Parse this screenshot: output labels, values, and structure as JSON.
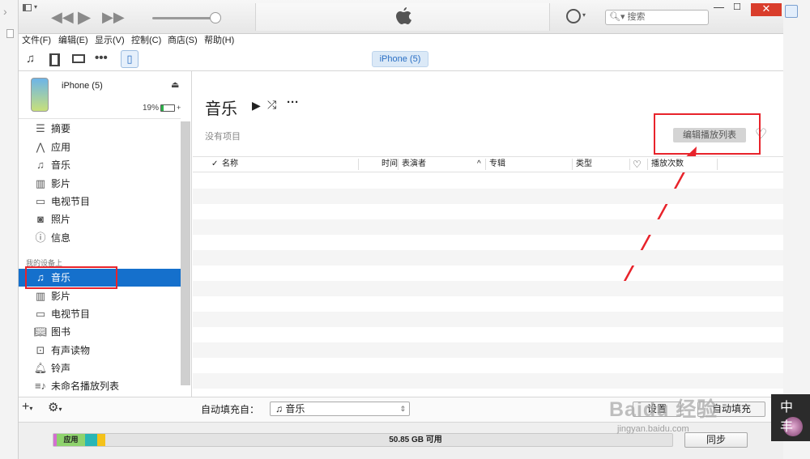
{
  "titlebar": {
    "search_placeholder": "搜索",
    "close_symbol": "✕",
    "minimize_symbol": "—",
    "maximize_symbol": "☐"
  },
  "menubar": {
    "items": [
      "文件(F)",
      "编辑(E)",
      "显示(V)",
      "控制(C)",
      "商店(S)",
      "帮助(H)"
    ]
  },
  "toolbar": {
    "device_pill": "iPhone (5)"
  },
  "device": {
    "name": "iPhone (5)",
    "battery_percent": "19%",
    "battery_level": 0.19
  },
  "sidebar": {
    "settings_items": [
      {
        "label": "摘要",
        "icon": "summary-icon"
      },
      {
        "label": "应用",
        "icon": "apps-icon"
      },
      {
        "label": "音乐",
        "icon": "music-icon"
      },
      {
        "label": "影片",
        "icon": "movies-icon"
      },
      {
        "label": "电视节目",
        "icon": "tv-icon"
      },
      {
        "label": "照片",
        "icon": "camera-icon"
      },
      {
        "label": "信息",
        "icon": "info-icon"
      }
    ],
    "section_label": "我的设备上",
    "device_items": [
      {
        "label": "音乐",
        "icon": "music-icon",
        "selected": true
      },
      {
        "label": "影片",
        "icon": "movies-icon"
      },
      {
        "label": "电视节目",
        "icon": "tv-icon"
      },
      {
        "label": "图书",
        "icon": "books-icon"
      },
      {
        "label": "有声读物",
        "icon": "audiobooks-icon"
      },
      {
        "label": "铃声",
        "icon": "bell-icon"
      },
      {
        "label": "未命名播放列表",
        "icon": "playlist-icon"
      }
    ]
  },
  "main": {
    "title": "音乐",
    "empty_text": "没有项目",
    "edit_playlist_button": "编辑播放列表",
    "columns": {
      "check": "✓",
      "name": "名称",
      "time": "时间",
      "artist": "表演者",
      "album": "专辑",
      "genre": "类型",
      "plays": "播放次数"
    }
  },
  "bottom": {
    "autofill_label": "自动填充自：",
    "autofill_value": "音乐",
    "settings_button": "设置",
    "autofill_button": "自动填充"
  },
  "capacity": {
    "apps_label": "应用",
    "free_label": "50.85 GB 可用",
    "sync_button": "同步",
    "colors": {
      "apps": "#8ed36d",
      "other1": "#d36fd1",
      "other2": "#29b6b6",
      "other3": "#f4c21a"
    }
  },
  "watermark": {
    "text": "Baidu 经验",
    "url": "jingyan.baidu.com",
    "badge_chars": [
      "中",
      "丰"
    ]
  },
  "annotation_color": "#e8232b"
}
